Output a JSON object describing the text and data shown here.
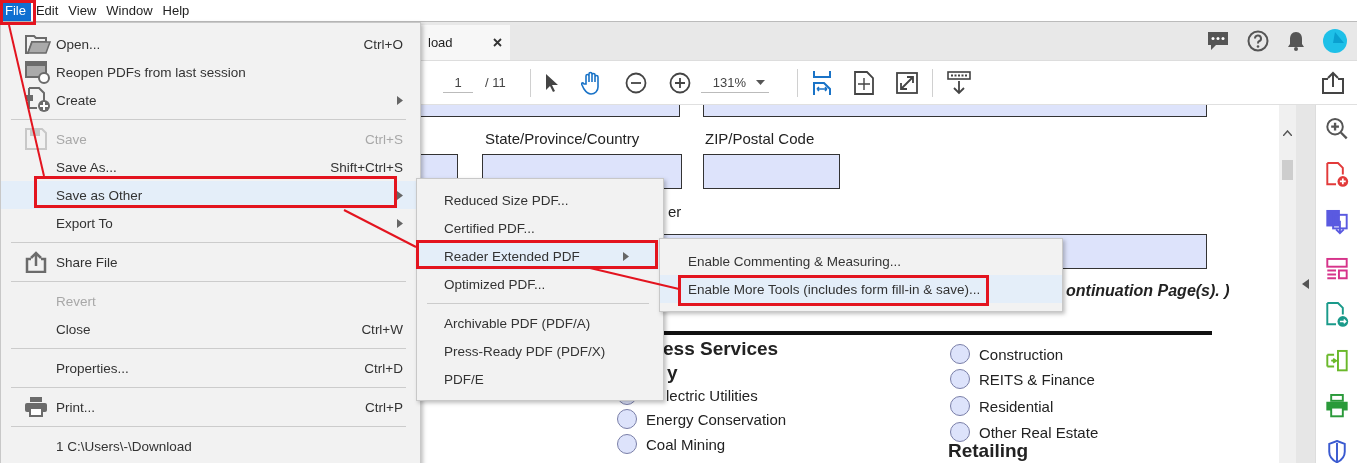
{
  "menubar": [
    {
      "label": "File",
      "selected": true
    },
    {
      "label": "Edit",
      "selected": false
    },
    {
      "label": "View",
      "selected": false
    },
    {
      "label": "Window",
      "selected": false
    },
    {
      "label": "Help",
      "selected": false
    }
  ],
  "tab": {
    "title": "load"
  },
  "toolbar": {
    "page": "1",
    "page_total": "/ 11",
    "zoom": "131%"
  },
  "document": {
    "labels": [
      "State/Province/Country",
      "ZIP/Postal Code",
      "er",
      "ontinuation Page(s). )",
      "ess Services",
      "y",
      "Retailing"
    ],
    "options": [
      {
        "label": "lectric Utilities",
        "selected": false
      },
      {
        "label": "Energy Conservation",
        "selected": false
      },
      {
        "label": "Coal Mining",
        "selected": false
      },
      {
        "label": "Construction",
        "selected": false
      },
      {
        "label": "REITS & Finance",
        "selected": false
      },
      {
        "label": "Residential",
        "selected": false
      },
      {
        "label": "Other Real Estate",
        "selected": false
      }
    ]
  },
  "file_menu": {
    "sections": [
      [
        {
          "label": "Open...",
          "shortcut": "Ctrl+O",
          "disabled": false,
          "selected": false,
          "submenu": false
        },
        {
          "label": "Reopen PDFs from last session",
          "disabled": false,
          "selected": false,
          "submenu": false
        },
        {
          "label": "Create",
          "disabled": false,
          "selected": false,
          "submenu": true
        }
      ],
      [
        {
          "label": "Save",
          "shortcut": "Ctrl+S",
          "disabled": true,
          "selected": false,
          "submenu": false
        },
        {
          "label": "Save As...",
          "shortcut": "Shift+Ctrl+S",
          "disabled": false,
          "selected": false,
          "submenu": false
        },
        {
          "label": "Save as Other",
          "disabled": false,
          "selected": true,
          "submenu": true
        },
        {
          "label": "Export To",
          "disabled": false,
          "selected": false,
          "submenu": true
        }
      ],
      [
        {
          "label": "Share File",
          "disabled": false,
          "selected": false,
          "submenu": false
        }
      ],
      [
        {
          "label": "Revert",
          "disabled": true,
          "selected": false,
          "submenu": false
        },
        {
          "label": "Close",
          "shortcut": "Ctrl+W",
          "disabled": false,
          "selected": false,
          "submenu": false
        }
      ],
      [
        {
          "label": "Properties...",
          "shortcut": "Ctrl+D",
          "disabled": false,
          "selected": false,
          "submenu": false
        }
      ],
      [
        {
          "label": "Print...",
          "shortcut": "Ctrl+P",
          "disabled": false,
          "selected": false,
          "submenu": false
        }
      ],
      [
        {
          "label": "1 C:\\Users\\-\\Download",
          "disabled": false,
          "selected": false,
          "submenu": false
        }
      ]
    ]
  },
  "save_as_other_menu": {
    "sections": [
      [
        {
          "label": "Reduced Size PDF...",
          "selected": false,
          "submenu": false
        },
        {
          "label": "Certified PDF...",
          "selected": false,
          "submenu": false
        },
        {
          "label": "Reader Extended PDF",
          "selected": true,
          "submenu": true
        },
        {
          "label": "Optimized PDF...",
          "selected": false,
          "submenu": false
        }
      ],
      [
        {
          "label": "Archivable PDF (PDF/A)",
          "selected": false,
          "submenu": false
        },
        {
          "label": "Press-Ready PDF (PDF/X)",
          "selected": false,
          "submenu": false
        },
        {
          "label": "PDF/E",
          "selected": false,
          "submenu": false
        }
      ]
    ]
  },
  "reader_extended_menu": {
    "sections": [
      [
        {
          "label": "Enable Commenting & Measuring...",
          "selected": false,
          "submenu": false
        },
        {
          "label": "Enable More Tools (includes form fill-in & save)...",
          "selected": true,
          "submenu": false
        }
      ]
    ]
  }
}
